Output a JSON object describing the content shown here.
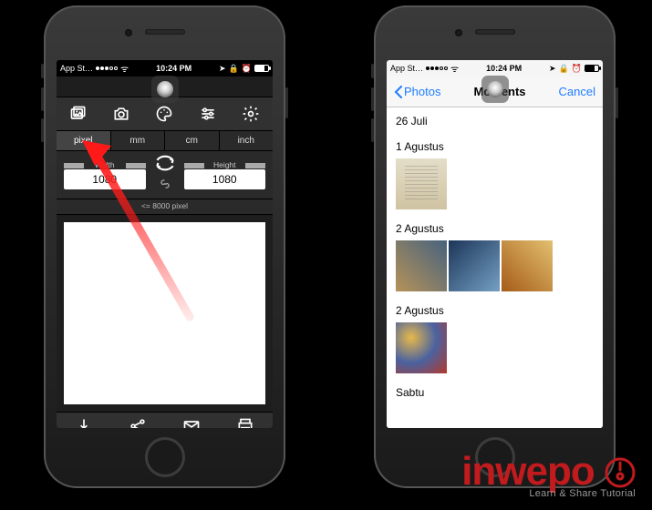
{
  "statusbar": {
    "carrier_back": "App St…",
    "time": "10:24 PM"
  },
  "editor": {
    "units": {
      "pixel": "pixel",
      "mm": "mm",
      "cm": "cm",
      "inch": "inch"
    },
    "labels": {
      "width": "Width",
      "height": "Height"
    },
    "values": {
      "width": "1080",
      "height": "1080"
    },
    "hint": "<= 8000 pixel"
  },
  "photos": {
    "back_label": "Photos",
    "title": "Moments",
    "cancel": "Cancel",
    "sections": [
      "26 Juli",
      "1 Agustus",
      "2 Agustus",
      "2 Agustus",
      "Sabtu"
    ]
  },
  "brand": {
    "name": "inwepo",
    "tagline": "Learn & Share Tutorial"
  }
}
